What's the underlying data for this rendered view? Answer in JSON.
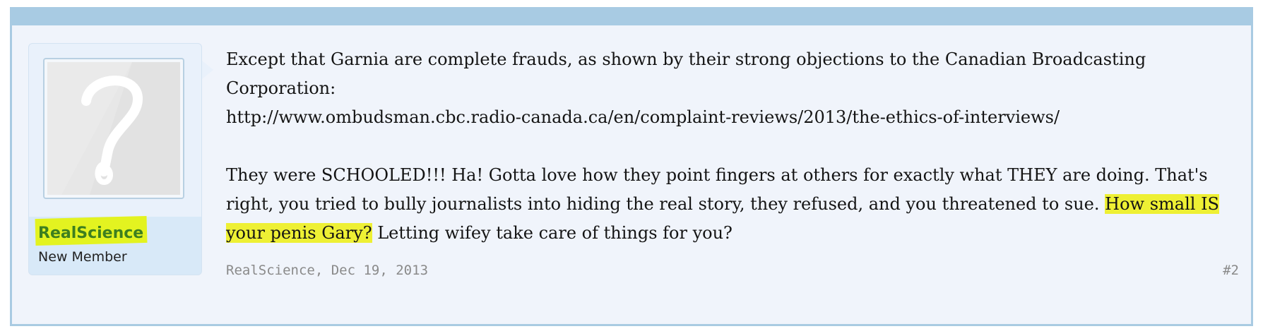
{
  "user": {
    "name": "RealScience",
    "title": "New Member",
    "avatar_icon": "question-mark-avatar-icon"
  },
  "message": {
    "line1": "Except that Garnia are complete frauds, as shown by their strong objections to the Canadian Broadcasting Corporation:",
    "url": "http://www.ombudsman.cbc.radio-canada.ca/en/complaint-reviews/2013/the-ethics-of-interviews/",
    "para2": "They were SCHOOLED!!! Ha! Gotta love how they point fingers at others for exactly what THEY are doing. That's right, you tried to bully journalists into hiding the real story, they refused, and you threatened to sue.",
    "highlight": "How small IS your penis Gary?",
    "tail": " Letting wifey take care of things for you?"
  },
  "meta": {
    "author": "RealScience",
    "separator": ", ",
    "date": "Dec 19, 2013",
    "post_number": "#2"
  },
  "colors": {
    "header_bar": "#a8cbe3",
    "username": "#3d7f1f",
    "highlight": "#eef034"
  }
}
